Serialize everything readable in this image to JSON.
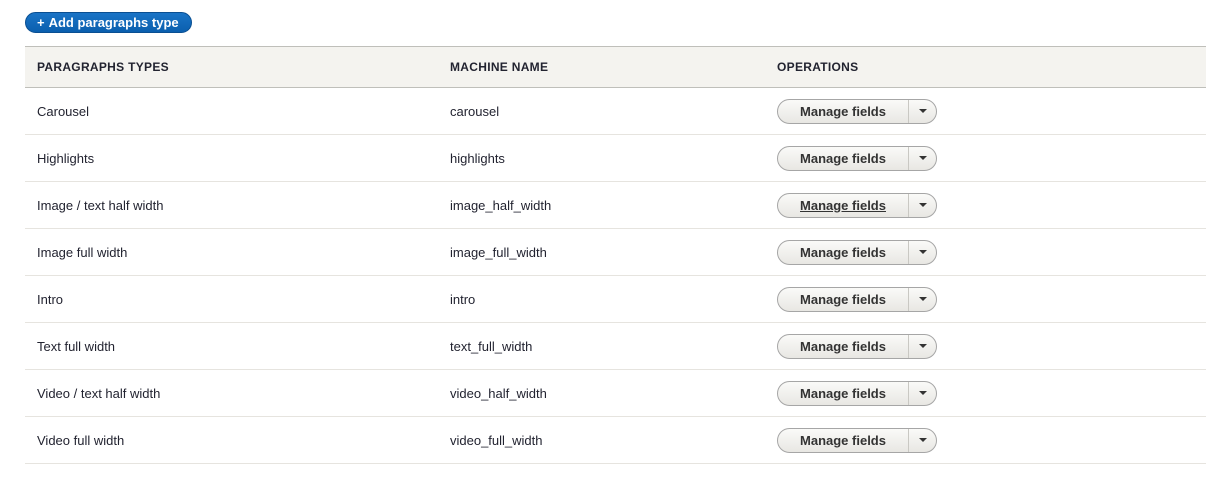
{
  "add_button": {
    "icon": "plus-icon",
    "plus": "+",
    "label": "Add paragraphs type"
  },
  "table": {
    "headers": {
      "name": "PARAGRAPHS TYPES",
      "machine": "MACHINE NAME",
      "operations": "OPERATIONS"
    },
    "rows": [
      {
        "name": "Carousel",
        "machine": "carousel",
        "op": "Manage fields"
      },
      {
        "name": "Highlights",
        "machine": "highlights",
        "op": "Manage fields"
      },
      {
        "name": "Image / text half width",
        "machine": "image_half_width",
        "op": "Manage fields"
      },
      {
        "name": "Image full width",
        "machine": "image_full_width",
        "op": "Manage fields"
      },
      {
        "name": "Intro",
        "machine": "intro",
        "op": "Manage fields"
      },
      {
        "name": "Text full width",
        "machine": "text_full_width",
        "op": "Manage fields"
      },
      {
        "name": "Video / text half width",
        "machine": "video_half_width",
        "op": "Manage fields"
      },
      {
        "name": "Video full width",
        "machine": "video_full_width",
        "op": "Manage fields"
      }
    ],
    "dropdown_icon": "chevron-down-icon"
  },
  "colors": {
    "primary_button": "#0b5fae",
    "header_bg": "#f4f3ef"
  }
}
